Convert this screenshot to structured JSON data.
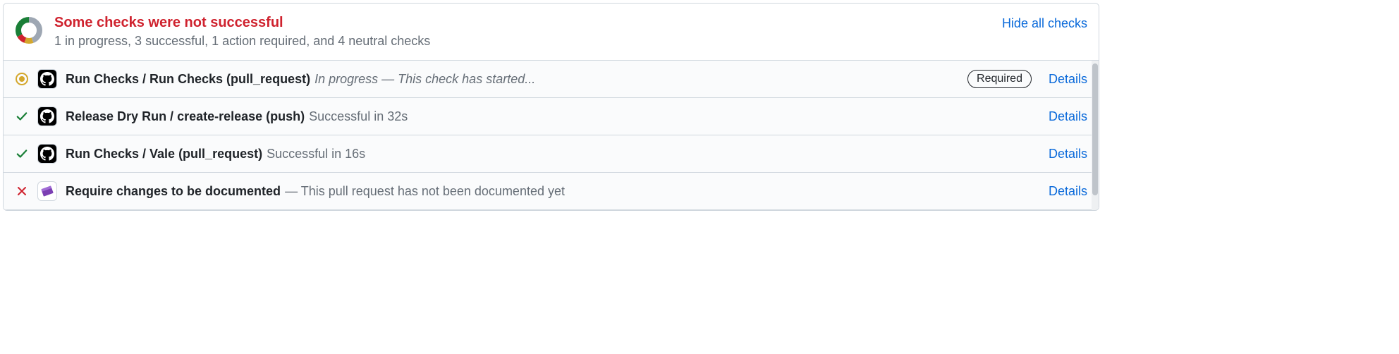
{
  "header": {
    "title": "Some checks were not successful",
    "subtitle": "1 in progress, 3 successful, 1 action required, and 4 neutral checks",
    "hide_all": "Hide all checks"
  },
  "colors": {
    "success": "#1a7f37",
    "danger": "#cf222e",
    "pending": "#d4a72c",
    "neutral": "#9ea7b3",
    "link": "#0969da"
  },
  "checks": [
    {
      "status": "in_progress",
      "avatar": "github",
      "name": "Run Checks / Run Checks (pull_request)",
      "message_prefix": "In progress",
      "message_sep": " — ",
      "message_rest": "This check has started...",
      "italic": true,
      "required_label": "Required",
      "details": "Details"
    },
    {
      "status": "success",
      "avatar": "github",
      "name": "Release Dry Run / create-release (push)",
      "message_prefix": "Successful in 32s",
      "message_sep": "",
      "message_rest": "",
      "italic": false,
      "required_label": "",
      "details": "Details"
    },
    {
      "status": "success",
      "avatar": "github",
      "name": "Run Checks / Vale (pull_request)",
      "message_prefix": "Successful in 16s",
      "message_sep": "",
      "message_rest": "",
      "italic": false,
      "required_label": "",
      "details": "Details"
    },
    {
      "status": "failure",
      "avatar": "app",
      "name": "Require changes to be documented",
      "message_prefix": "",
      "message_sep": " — ",
      "message_rest": "This pull request has not been documented yet",
      "italic": false,
      "required_label": "",
      "details": "Details"
    }
  ]
}
